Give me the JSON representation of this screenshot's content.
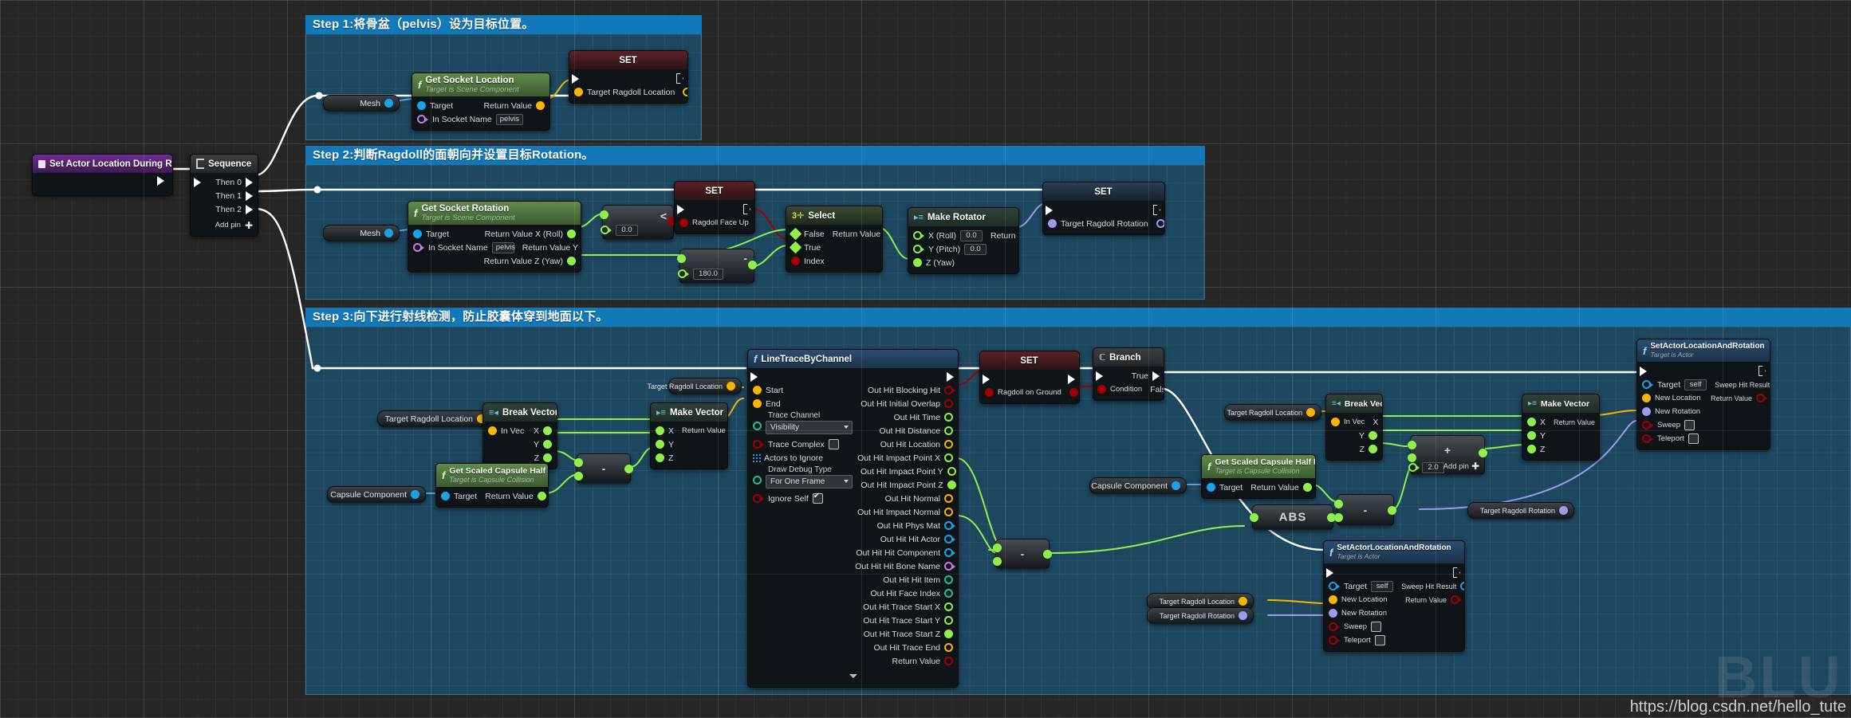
{
  "watermark": {
    "url": "https://blog.csdn.net/hello_tute",
    "logo": "BLU"
  },
  "comments": [
    {
      "title": "Step 1:将骨盆（pelvis）设为目标位置。"
    },
    {
      "title": "Step 2:判断Ragdoll的面朝向并设置目标Rotation。"
    },
    {
      "title": "Step 3:向下进行射线检测，防止胶囊体穿到地面以下。"
    }
  ],
  "entry": {
    "title": "Set Actor Location During Ragdoll"
  },
  "sequence": {
    "title": "Sequence",
    "outputs": [
      "Then 0",
      "Then 1",
      "Then 2"
    ],
    "add_pin": "Add pin"
  },
  "step1": {
    "mesh_pill": "Mesh",
    "get_socket_location": {
      "title": "Get Socket Location",
      "subtitle": "Target is Scene Component",
      "inputs": [
        "Target",
        "In Socket Name"
      ],
      "socket_value": "pelvis",
      "outputs": [
        "Return Value"
      ]
    },
    "set_node": {
      "title": "SET",
      "pin": "Target Ragdoll Location"
    }
  },
  "step2": {
    "mesh_pill": "Mesh",
    "get_socket_rotation": {
      "title": "Get Socket Rotation",
      "subtitle": "Target is Scene Component",
      "inputs": [
        "Target",
        "In Socket Name"
      ],
      "socket_value": "pelvis",
      "outputs": [
        "Return Value X (Roll)",
        "Return Value Y (Pitch)",
        "Return Value Z (Yaw)"
      ]
    },
    "less_node": {
      "op": "<",
      "value": "0.0"
    },
    "sub_node": {
      "op": "-",
      "value": "180.0"
    },
    "set_face_up": {
      "title": "SET",
      "pin": "Ragdoll Face Up"
    },
    "select": {
      "title": "Select",
      "inputs": [
        "False",
        "True",
        "Index"
      ],
      "outputs": [
        "Return Value"
      ]
    },
    "make_rotator": {
      "title": "Make Rotator",
      "inputs": [
        "X (Roll)",
        "Y (Pitch)",
        "Z (Yaw)"
      ],
      "values": [
        "0.0",
        "0.0"
      ],
      "outputs": [
        "Return Value"
      ]
    },
    "set_rotation": {
      "title": "SET",
      "pin": "Target Ragdoll Rotation"
    }
  },
  "step3": {
    "pill_target_location_a": "Target Ragdoll Location",
    "pill_capsule_a": "Capsule Component",
    "pill_target_location_b": "Target Ragdoll Location",
    "pill_target_location_c": "Target Ragdoll Location",
    "pill_capsule_b": "Capsule Component",
    "pill_target_location_d": "Target Ragdoll Location",
    "pill_target_rotation_a": "Target Ragdoll Rotation",
    "pill_target_location_e": "Target Ragdoll Location",
    "pill_target_rotation_b": "Target Ragdoll Rotation",
    "break_vector_a": {
      "title": "Break Vector",
      "input": "In Vec",
      "outputs": [
        "X",
        "Y",
        "Z"
      ]
    },
    "make_vector_a": {
      "title": "Make Vector",
      "inputs": [
        "X",
        "Y",
        "Z"
      ],
      "output": "Return Value"
    },
    "capsule_half_height_a": {
      "title": "Get Scaled Capsule Half Height",
      "subtitle": "Target is Capsule Collision",
      "input": "Target",
      "output": "Return Value"
    },
    "sub_a": {
      "op": "-"
    },
    "line_trace": {
      "title": "LineTraceByChannel",
      "inputs": [
        "Start",
        "End"
      ],
      "trace_channel_label": "Trace Channel",
      "trace_channel_value": "Visibility",
      "trace_complex": "Trace Complex",
      "actors_to_ignore": "Actors to Ignore",
      "draw_debug_label": "Draw Debug Type",
      "draw_debug_value": "For One Frame",
      "ignore_self": "Ignore Self",
      "ignore_self_checked": true,
      "outputs": [
        "Out Hit Blocking Hit",
        "Out Hit Initial Overlap",
        "Out Hit Time",
        "Out Hit Distance",
        "Out Hit Location",
        "Out Hit Impact Point X",
        "Out Hit Impact Point Y",
        "Out Hit Impact Point Z",
        "Out Hit Normal",
        "Out Hit Impact Normal",
        "Out Hit Phys Mat",
        "Out Hit Hit Actor",
        "Out Hit Hit Component",
        "Out Hit Hit Bone Name",
        "Out Hit Hit Item",
        "Out Hit Face Index",
        "Out Hit Trace Start X",
        "Out Hit Trace Start Y",
        "Out Hit Trace Start Z",
        "Out Hit Trace End",
        "Return Value"
      ]
    },
    "set_on_ground": {
      "title": "SET",
      "pin": "Ragdoll on Ground"
    },
    "branch": {
      "title": "Branch",
      "input": "Condition",
      "outputs": [
        "True",
        "False"
      ]
    },
    "capsule_half_height_b": {
      "title": "Get Scaled Capsule Half Height",
      "subtitle": "Target is Capsule Collision",
      "input": "Target",
      "output": "Return Value"
    },
    "break_vector_b": {
      "title": "Break Vector",
      "input": "In Vec",
      "outputs": [
        "X",
        "Y",
        "Z"
      ]
    },
    "make_vector_b": {
      "title": "Make Vector",
      "inputs": [
        "X",
        "Y",
        "Z"
      ],
      "output": "Return Value"
    },
    "abs_node": {
      "op": "ABS"
    },
    "sub_b": {
      "op": "-"
    },
    "add_node": {
      "op": "+",
      "value": "2.0",
      "add_pin": "Add pin"
    },
    "set_actor_loc_rot_a": {
      "title": "SetActorLocationAndRotation",
      "subtitle": "Target is Actor",
      "inputs": [
        "Target",
        "New Location",
        "New Rotation",
        "Sweep",
        "Teleport"
      ],
      "target_value": "self",
      "outputs": [
        "Sweep Hit Result",
        "Return Value"
      ]
    },
    "set_actor_loc_rot_b": {
      "title": "SetActorLocationAndRotation",
      "subtitle": "Target is Actor",
      "inputs": [
        "Target",
        "New Location",
        "New Rotation",
        "Sweep",
        "Teleport"
      ],
      "target_value": "self",
      "outputs": [
        "Sweep Hit Result",
        "Return Value"
      ]
    }
  }
}
